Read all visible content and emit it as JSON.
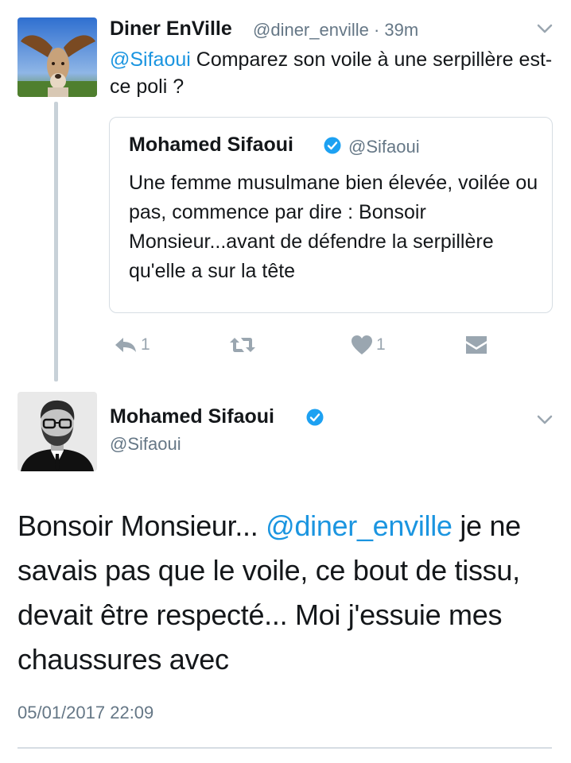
{
  "reply_tweet": {
    "display_name": "Diner EnVille",
    "handle_time": "@diner_enville · 39m",
    "mention": "@Sifaoui",
    "text": " Comparez son voile à une serpillère est-ce poli ?",
    "avatar_icon": "basset-hound-avatar",
    "menu_icon": "chevron-down-icon"
  },
  "quoted_tweet": {
    "display_name": "Mohamed Sifaoui",
    "verified": true,
    "handle": "@Sifaoui",
    "text": "Une femme musulmane bien élevée, voilée ou pas, commence par dire : Bonsoir Monsieur...avant de défendre la serpillère qu'elle a sur la tête"
  },
  "actions": {
    "reply_count": "1",
    "retweet_count": "",
    "like_count": "1",
    "icons": [
      "reply-icon",
      "retweet-icon",
      "heart-icon",
      "message-icon"
    ]
  },
  "main_tweet": {
    "display_name": "Mohamed Sifaoui",
    "verified": true,
    "handle": "@Sifaoui",
    "text_before": "Bonsoir Monsieur... ",
    "mention": "@diner_enville",
    "text_after": " je ne savais pas que le voile, ce bout de tissu, devait être respecté... Moi j'essuie mes chaussures avec",
    "timestamp": "05/01/2017 22:09",
    "menu_icon": "chevron-down-icon"
  },
  "colors": {
    "link": "#1b95e0",
    "secondary_text": "#657786",
    "icon_gray": "#9aa6b0",
    "verified_blue": "#1da1f2",
    "border": "#d6dde3"
  }
}
